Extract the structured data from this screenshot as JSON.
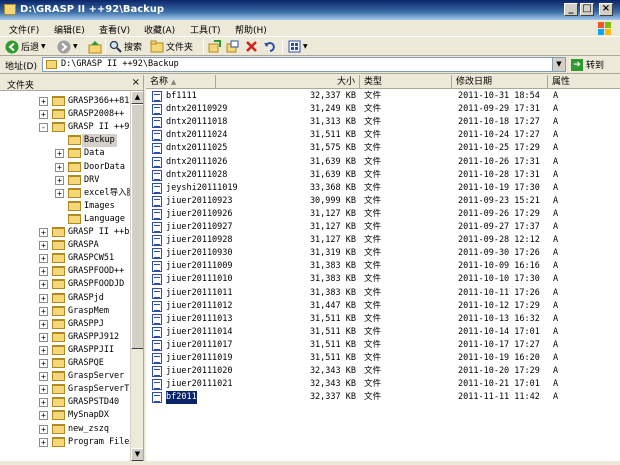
{
  "window": {
    "title": "D:\\GRASP II ++92\\Backup",
    "min": "_",
    "max": "□",
    "close": "×"
  },
  "menu": [
    "文件(F)",
    "编辑(E)",
    "查看(V)",
    "收藏(A)",
    "工具(T)",
    "帮助(H)"
  ],
  "toolbar": {
    "back": "后退",
    "search": "搜索",
    "folders": "文件夹"
  },
  "address": {
    "label": "地址(D)",
    "path": "D:\\GRASP II ++92\\Backup",
    "go": "转到"
  },
  "folders_pane": {
    "title": "文件夹",
    "close": "×",
    "items": [
      {
        "name": "GRASP366++81",
        "level": 2,
        "expander": "+",
        "selected": false
      },
      {
        "name": "GRASP2008++",
        "level": 2,
        "expander": "+",
        "selected": false
      },
      {
        "name": "GRASP II ++92",
        "level": 2,
        "expander": "-",
        "selected": false
      },
      {
        "name": "Backup",
        "level": 3,
        "expander": "",
        "selected": true
      },
      {
        "name": "Data",
        "level": 3,
        "expander": "+",
        "selected": false
      },
      {
        "name": "DoorData",
        "level": 3,
        "expander": "+",
        "selected": false
      },
      {
        "name": "DRV",
        "level": 3,
        "expander": "+",
        "selected": false
      },
      {
        "name": "excel导入脚",
        "level": 3,
        "expander": "+",
        "selected": false
      },
      {
        "name": "Images",
        "level": 3,
        "expander": "",
        "selected": false
      },
      {
        "name": "Language",
        "level": 3,
        "expander": "",
        "selected": false
      },
      {
        "name": "GRASP II ++bp",
        "level": 2,
        "expander": "+",
        "selected": false
      },
      {
        "name": "GRASPA",
        "level": 2,
        "expander": "+",
        "selected": false
      },
      {
        "name": "GRASPCW51",
        "level": 2,
        "expander": "+",
        "selected": false
      },
      {
        "name": "GRASPFOOD++",
        "level": 2,
        "expander": "+",
        "selected": false
      },
      {
        "name": "GRASPFOODJD",
        "level": 2,
        "expander": "+",
        "selected": false
      },
      {
        "name": "GRASPjd",
        "level": 2,
        "expander": "+",
        "selected": false
      },
      {
        "name": "GraspMem",
        "level": 2,
        "expander": "+",
        "selected": false
      },
      {
        "name": "GRASPPJ",
        "level": 2,
        "expander": "+",
        "selected": false
      },
      {
        "name": "GRASPPJ912",
        "level": 2,
        "expander": "+",
        "selected": false
      },
      {
        "name": "GRASPPJII",
        "level": 2,
        "expander": "+",
        "selected": false
      },
      {
        "name": "GRASPQE",
        "level": 2,
        "expander": "+",
        "selected": false
      },
      {
        "name": "GraspServer",
        "level": 2,
        "expander": "+",
        "selected": false
      },
      {
        "name": "GraspServerT8",
        "level": 2,
        "expander": "+",
        "selected": false
      },
      {
        "name": "GRASPSTD40",
        "level": 2,
        "expander": "+",
        "selected": false
      },
      {
        "name": "MySnapDX",
        "level": 2,
        "expander": "+",
        "selected": false
      },
      {
        "name": "new_zszq",
        "level": 2,
        "expander": "+",
        "selected": false
      },
      {
        "name": "Program Files",
        "level": 2,
        "expander": "+",
        "selected": false
      }
    ]
  },
  "columns": {
    "name": "名称",
    "size": "大小",
    "type": "类型",
    "modified": "修改日期",
    "attr": "属性"
  },
  "files": [
    {
      "name": "bf1111",
      "size": "32,337 KB",
      "type": "文件",
      "modified": "2011-10-31 18:54",
      "attr": "A"
    },
    {
      "name": "dntx20110929",
      "size": "31,249 KB",
      "type": "文件",
      "modified": "2011-09-29 17:31",
      "attr": "A"
    },
    {
      "name": "dntx20111018",
      "size": "31,313 KB",
      "type": "文件",
      "modified": "2011-10-18 17:27",
      "attr": "A"
    },
    {
      "name": "dntx20111024",
      "size": "31,511 KB",
      "type": "文件",
      "modified": "2011-10-24 17:27",
      "attr": "A"
    },
    {
      "name": "dntx20111025",
      "size": "31,575 KB",
      "type": "文件",
      "modified": "2011-10-25 17:29",
      "attr": "A"
    },
    {
      "name": "dntx20111026",
      "size": "31,639 KB",
      "type": "文件",
      "modified": "2011-10-26 17:31",
      "attr": "A"
    },
    {
      "name": "dntx20111028",
      "size": "31,639 KB",
      "type": "文件",
      "modified": "2011-10-28 17:31",
      "attr": "A"
    },
    {
      "name": "jeyshi20111019",
      "size": "33,368 KB",
      "type": "文件",
      "modified": "2011-10-19 17:30",
      "attr": "A"
    },
    {
      "name": "jiuer20110923",
      "size": "30,999 KB",
      "type": "文件",
      "modified": "2011-09-23 15:21",
      "attr": "A"
    },
    {
      "name": "jiuer20110926",
      "size": "31,127 KB",
      "type": "文件",
      "modified": "2011-09-26 17:29",
      "attr": "A"
    },
    {
      "name": "jiuer20110927",
      "size": "31,127 KB",
      "type": "文件",
      "modified": "2011-09-27 17:37",
      "attr": "A"
    },
    {
      "name": "jiuer20110928",
      "size": "31,127 KB",
      "type": "文件",
      "modified": "2011-09-28 12:12",
      "attr": "A"
    },
    {
      "name": "jiuer20110930",
      "size": "31,319 KB",
      "type": "文件",
      "modified": "2011-09-30 17:26",
      "attr": "A"
    },
    {
      "name": "jiuer20111009",
      "size": "31,383 KB",
      "type": "文件",
      "modified": "2011-10-09 16:16",
      "attr": "A"
    },
    {
      "name": "jiuer20111010",
      "size": "31,383 KB",
      "type": "文件",
      "modified": "2011-10-10 17:30",
      "attr": "A"
    },
    {
      "name": "jiuer20111011",
      "size": "31,383 KB",
      "type": "文件",
      "modified": "2011-10-11 17:26",
      "attr": "A"
    },
    {
      "name": "jiuer20111012",
      "size": "31,447 KB",
      "type": "文件",
      "modified": "2011-10-12 17:29",
      "attr": "A"
    },
    {
      "name": "jiuer20111013",
      "size": "31,511 KB",
      "type": "文件",
      "modified": "2011-10-13 16:32",
      "attr": "A"
    },
    {
      "name": "jiuer20111014",
      "size": "31,511 KB",
      "type": "文件",
      "modified": "2011-10-14 17:01",
      "attr": "A"
    },
    {
      "name": "jiuer20111017",
      "size": "31,511 KB",
      "type": "文件",
      "modified": "2011-10-17 17:27",
      "attr": "A"
    },
    {
      "name": "jiuer20111019",
      "size": "31,511 KB",
      "type": "文件",
      "modified": "2011-10-19 16:20",
      "attr": "A"
    },
    {
      "name": "jiuer20111020",
      "size": "32,343 KB",
      "type": "文件",
      "modified": "2011-10-20 17:29",
      "attr": "A"
    },
    {
      "name": "jiuer20111021",
      "size": "32,343 KB",
      "type": "文件",
      "modified": "2011-10-21 17:01",
      "attr": "A"
    },
    {
      "name": "bf2011",
      "size": "32,337 KB",
      "type": "文件",
      "modified": "2011-11-11 11:42",
      "attr": "A",
      "selected": true
    }
  ],
  "colors": {
    "title_bar": "#0a246a",
    "selection": "#0a246a",
    "folder": "#f5d77a"
  }
}
